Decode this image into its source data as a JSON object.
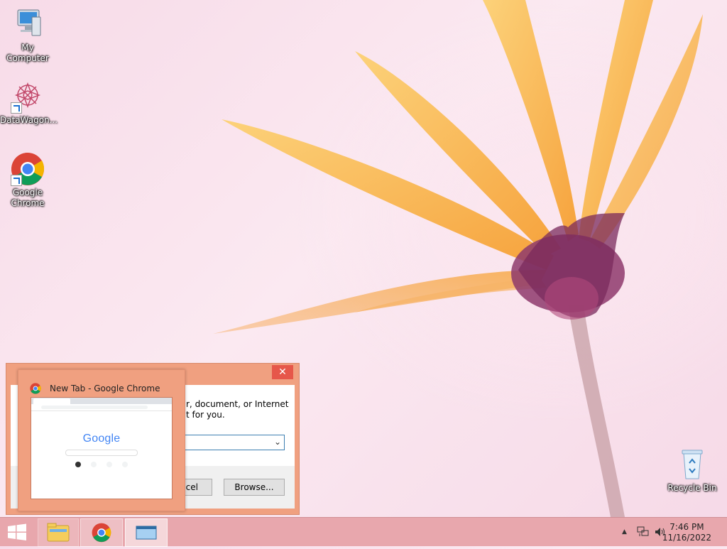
{
  "desktop": {
    "icons": [
      {
        "label": "My Computer"
      },
      {
        "label": "DataWagon..."
      },
      {
        "label": "Google Chrome"
      },
      {
        "label": "Recycle Bin"
      }
    ]
  },
  "run_dialog": {
    "close_symbol": "✕",
    "description": "r, document, or Internet t for you.",
    "input_value": "",
    "cancel_label": "ncel",
    "browse_label": "Browse..."
  },
  "preview": {
    "title": "New Tab - Google Chrome",
    "logo_text": "Google"
  },
  "taskbar": {
    "time": "7:46 PM",
    "date": "11/16/2022",
    "tray_arrow": "▲"
  },
  "colors": {
    "accent": "#f0a080",
    "taskbar": "#e8a7ad",
    "close": "#e6574a"
  }
}
